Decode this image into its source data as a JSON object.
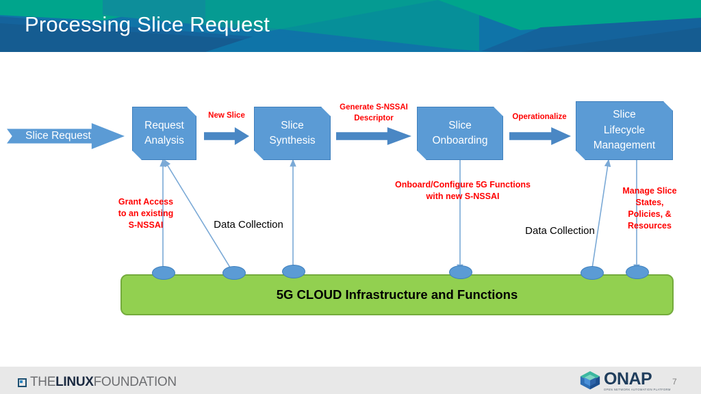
{
  "header": {
    "title": "Processing Slice Request",
    "bg_color": "#006b80",
    "accent_teal": "#00a58c",
    "accent_blue": "#0f74a8",
    "accent_darkblue": "#14639c"
  },
  "diagram": {
    "entry_arrow": {
      "label": "Slice Request"
    },
    "boxes": [
      {
        "id": "request-analysis",
        "label": "Request\nAnalysis"
      },
      {
        "id": "slice-synthesis",
        "label": "Slice\nSynthesis"
      },
      {
        "id": "slice-onboarding",
        "label": "Slice\nOnboarding"
      },
      {
        "id": "slice-lifecycle-management",
        "label": "Slice\nLifecycle\nManagement"
      }
    ],
    "flow_labels": [
      {
        "id": "new-slice",
        "text": "New Slice"
      },
      {
        "id": "generate-descriptor",
        "text": "Generate S-NSSAI\nDescriptor"
      },
      {
        "id": "operationalize",
        "text": "Operationalize"
      }
    ],
    "annotations_red": [
      {
        "id": "grant-access",
        "text": "Grant Access\nto an existing\nS-NSSAI"
      },
      {
        "id": "onboard-configure",
        "text": "Onboard/Configure 5G Functions\nwith new S-NSSAI"
      },
      {
        "id": "manage-slice",
        "text": "Manage Slice\nStates,\nPolicies, &\nResources"
      }
    ],
    "annotations_black": [
      {
        "id": "data-collection-left",
        "text": "Data Collection"
      },
      {
        "id": "data-collection-right",
        "text": "Data Collection"
      }
    ],
    "infrastructure_bar": {
      "label": "5G CLOUD Infrastructure and Functions"
    },
    "colors": {
      "box_fill": "#5b9bd5",
      "box_stroke": "#3d7ebc",
      "bar_fill": "#92d050",
      "bar_stroke": "#74ab3c",
      "red_text": "#ff0000",
      "connector": "#7aa9d6"
    }
  },
  "footer": {
    "linux_foundation": {
      "the": "THE",
      "linux": "LINUX",
      "foundation": "FOUNDATION"
    },
    "onap": {
      "name": "ONAP",
      "tagline": "OPEN NETWORK AUTOMATION PLATFORM"
    },
    "page_number": "7"
  }
}
